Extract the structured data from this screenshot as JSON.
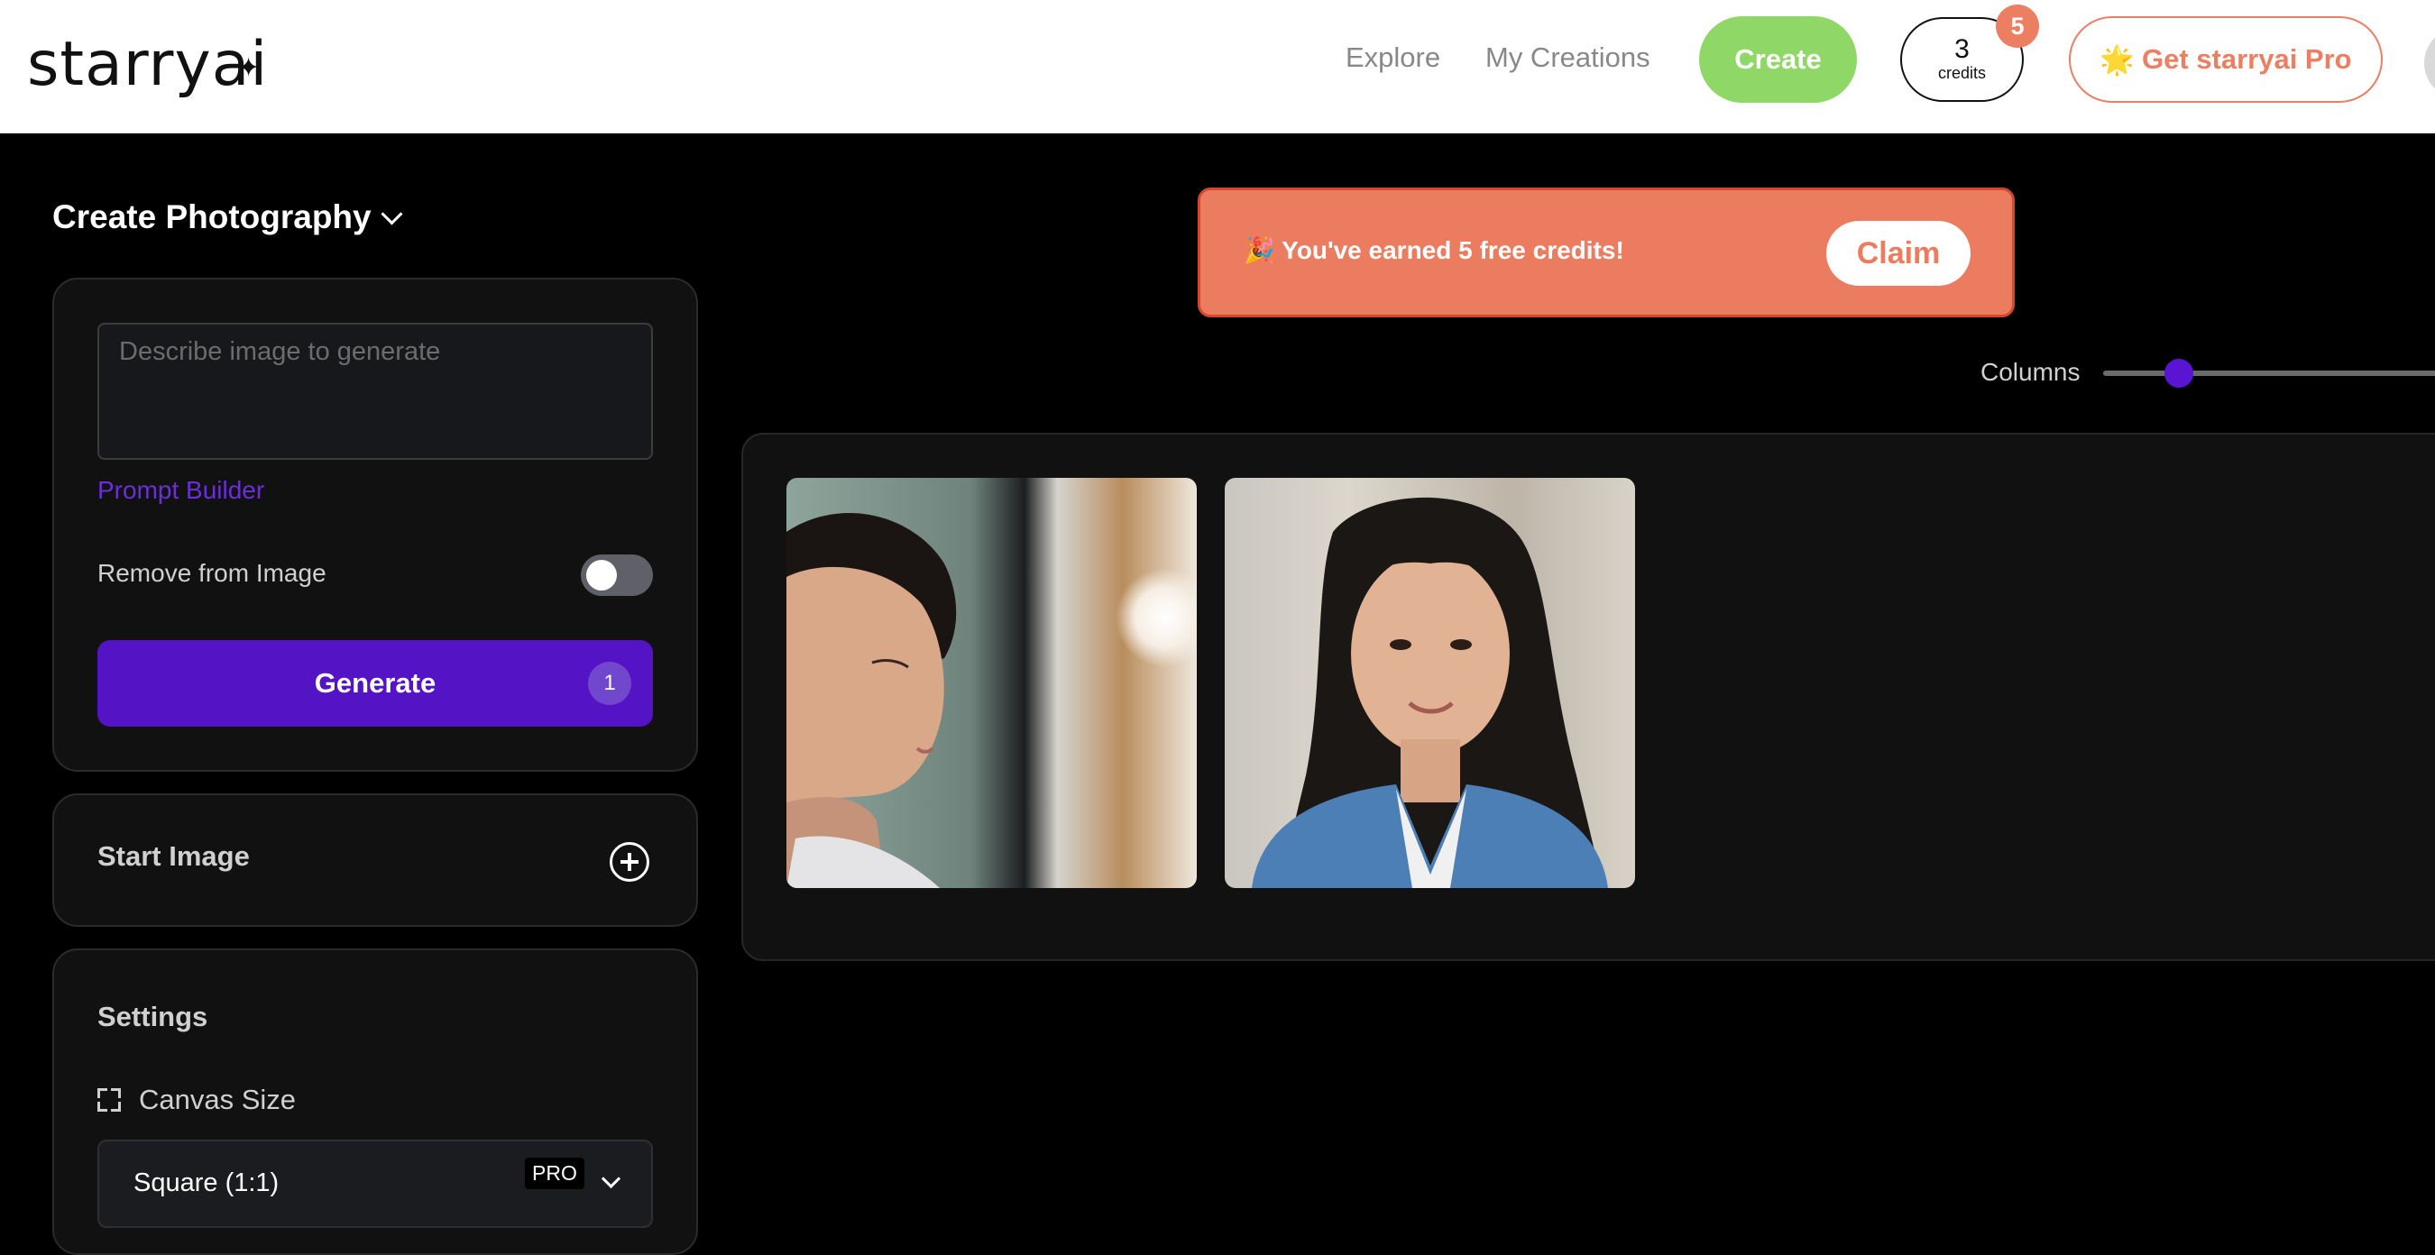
{
  "header": {
    "logo": "starryai",
    "logo_mark": "✦",
    "nav": {
      "explore": "Explore",
      "my_creations": "My Creations",
      "create": "Create"
    },
    "credits": {
      "count": "3",
      "label": "credits",
      "badge": "5"
    },
    "pro_button": {
      "icon": "🌟",
      "label": "Get starryai Pro"
    }
  },
  "sidebar": {
    "mode_title": "Create Photography",
    "prompt": {
      "placeholder": "Describe image to generate",
      "value": ""
    },
    "prompt_builder": "Prompt Builder",
    "remove_from_image": {
      "label": "Remove from Image",
      "enabled": false
    },
    "generate": {
      "label": "Generate",
      "count": "1"
    },
    "start_image": {
      "label": "Start Image"
    },
    "settings": {
      "title": "Settings",
      "canvas_size": {
        "label": "Canvas Size",
        "value": "Square (1:1)",
        "tag": "PRO"
      }
    }
  },
  "main": {
    "banner": {
      "text": "🎉 You've earned 5 free credits!",
      "claim": "Claim"
    },
    "columns": {
      "label": "Columns"
    },
    "gallery": {
      "images": [
        {
          "name": "portrait-profile"
        },
        {
          "name": "portrait-smiling"
        }
      ]
    }
  },
  "colors": {
    "accent_purple": "#5414c6",
    "create_green": "#8fd766",
    "promo_coral": "#ec7c5f"
  }
}
